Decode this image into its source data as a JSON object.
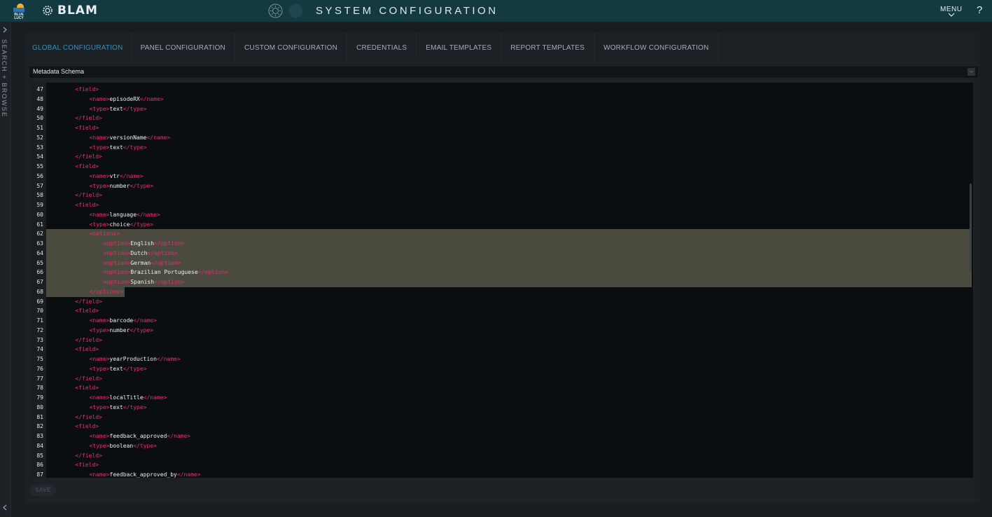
{
  "header": {
    "bl_logo_text": "BLUE LUCY",
    "brand": "BLAM",
    "title": "SYSTEM CONFIGURATION",
    "menu_label": "MENU",
    "help_label": "?"
  },
  "sidebar": {
    "label": "SEARCH + BROWSE"
  },
  "tabs": [
    {
      "label": "GLOBAL CONFIGURATION",
      "active": true
    },
    {
      "label": "PANEL CONFIGURATION",
      "active": false
    },
    {
      "label": "CUSTOM CONFIGURATION",
      "active": false
    },
    {
      "label": "CREDENTIALS",
      "active": false
    },
    {
      "label": "EMAIL TEMPLATES",
      "active": false
    },
    {
      "label": "REPORT TEMPLATES",
      "active": false
    },
    {
      "label": "WORKFLOW CONFIGURATION",
      "active": false
    }
  ],
  "section": {
    "title": "Metadata Schema"
  },
  "editor": {
    "selected_lines": [
      62,
      68
    ],
    "lines": [
      {
        "n": "47",
        "indent": 2,
        "code": "<field>"
      },
      {
        "n": "48",
        "indent": 3,
        "code": "<name>episodeRX</name>"
      },
      {
        "n": "49",
        "indent": 3,
        "code": "<type>text</type>"
      },
      {
        "n": "50",
        "indent": 2,
        "code": "</field>"
      },
      {
        "n": "51",
        "indent": 2,
        "code": "<field>"
      },
      {
        "n": "52",
        "indent": 3,
        "code": "<name>versionName</name>"
      },
      {
        "n": "53",
        "indent": 3,
        "code": "<type>text</type>"
      },
      {
        "n": "54",
        "indent": 2,
        "code": "</field>"
      },
      {
        "n": "55",
        "indent": 2,
        "code": "<field>"
      },
      {
        "n": "56",
        "indent": 3,
        "code": "<name>vtr</name>"
      },
      {
        "n": "57",
        "indent": 3,
        "code": "<type>number</type>"
      },
      {
        "n": "58",
        "indent": 2,
        "code": "</field>"
      },
      {
        "n": "59",
        "indent": 2,
        "code": "<field>"
      },
      {
        "n": "60",
        "indent": 3,
        "code": "<name>language</name>"
      },
      {
        "n": "61",
        "indent": 3,
        "code": "<type>choice</type>"
      },
      {
        "n": "62",
        "indent": 3,
        "code": "<options>"
      },
      {
        "n": "63",
        "indent": 4,
        "code": "<option>English</option>"
      },
      {
        "n": "64",
        "indent": 4,
        "code": "<option>Dutch</option>"
      },
      {
        "n": "65",
        "indent": 4,
        "code": "<option>German</option>"
      },
      {
        "n": "66",
        "indent": 4,
        "code": "<option>Brazilian Portuguese</option>"
      },
      {
        "n": "67",
        "indent": 4,
        "code": "<option>Spanish</option>"
      },
      {
        "n": "68",
        "indent": 3,
        "code": "</options>"
      },
      {
        "n": "69",
        "indent": 2,
        "code": "</field>"
      },
      {
        "n": "70",
        "indent": 2,
        "code": "<field>"
      },
      {
        "n": "71",
        "indent": 3,
        "code": "<name>barcode</name>"
      },
      {
        "n": "72",
        "indent": 3,
        "code": "<type>number</type>"
      },
      {
        "n": "73",
        "indent": 2,
        "code": "</field>"
      },
      {
        "n": "74",
        "indent": 2,
        "code": "<field>"
      },
      {
        "n": "75",
        "indent": 3,
        "code": "<name>yearProduction</name>"
      },
      {
        "n": "76",
        "indent": 3,
        "code": "<type>text</type>"
      },
      {
        "n": "77",
        "indent": 2,
        "code": "</field>"
      },
      {
        "n": "78",
        "indent": 2,
        "code": "<field>"
      },
      {
        "n": "79",
        "indent": 3,
        "code": "<name>localTitle</name>"
      },
      {
        "n": "80",
        "indent": 3,
        "code": "<type>text</type>"
      },
      {
        "n": "81",
        "indent": 2,
        "code": "</field>"
      },
      {
        "n": "82",
        "indent": 2,
        "code": "<field>"
      },
      {
        "n": "83",
        "indent": 3,
        "code": "<name>feedback_approved</name>"
      },
      {
        "n": "84",
        "indent": 3,
        "code": "<type>boolean</type>"
      },
      {
        "n": "85",
        "indent": 2,
        "code": "</field>"
      },
      {
        "n": "86",
        "indent": 2,
        "code": "<field>"
      },
      {
        "n": "87",
        "indent": 3,
        "code": "<name>feedback_approved_by</name>"
      }
    ]
  },
  "footer": {
    "save_label": "SAVE"
  },
  "colors": {
    "topbar": "#133a40",
    "accent": "#3e8fb3",
    "tag": "#e9306b",
    "selection": "#4a4a3f"
  }
}
